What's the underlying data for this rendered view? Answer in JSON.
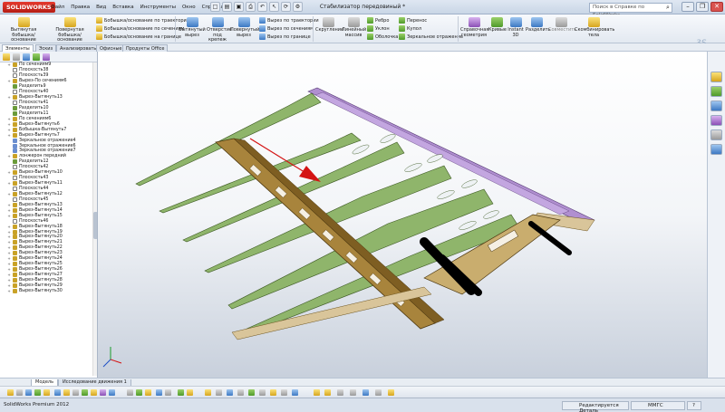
{
  "app": {
    "logo": "SOLIDWORKS",
    "document_title": "Стабилизатор передовиный *",
    "menu": [
      "Файл",
      "Правка",
      "Вид",
      "Вставка",
      "Инструменты",
      "Окно",
      "Справка"
    ],
    "search_placeholder": "Поиск в Справке по SolidWorks",
    "window_controls": [
      "minimize-icon",
      "restore-icon",
      "close-icon"
    ]
  },
  "ribbon": {
    "big_buttons": [
      {
        "label": "Вытянутая бобышка/основание",
        "icon": "extrude-boss-icon"
      },
      {
        "label": "Повернутая бобышка/основание",
        "icon": "revolve-boss-icon"
      },
      {
        "label": "Вытянутый вырез",
        "icon": "extrude-cut-icon"
      },
      {
        "label": "Отверстие под крепеж",
        "icon": "hole-wizard-icon"
      },
      {
        "label": "Повернутый вырез",
        "icon": "revolve-cut-icon"
      },
      {
        "label": "Скругление",
        "icon": "fillet-icon"
      },
      {
        "label": "Линейный массив",
        "icon": "linear-pattern-icon"
      },
      {
        "label": "Справочная геометрия",
        "icon": "reference-geometry-icon"
      },
      {
        "label": "Кривые",
        "icon": "curves-icon"
      },
      {
        "label": "Instant 3D",
        "icon": "instant3d-icon"
      },
      {
        "label": "Разделить",
        "icon": "split-icon"
      },
      {
        "label": "Совместить",
        "icon": "combine-disabled-icon"
      },
      {
        "label": "Скомбинировать тела",
        "icon": "combine-bodies-icon"
      }
    ],
    "small_items": [
      "Бобышка/основание по траектории",
      "Бобышка/основание по сечениям",
      "Бобышка/основание на границе",
      "Вырез по траектории",
      "Вырез по сечениям",
      "Вырез по границе",
      "Ребро",
      "Уклон",
      "Оболочка",
      "Перенос",
      "Купол",
      "Зеркальное отражение"
    ]
  },
  "tabs": [
    "Элементы",
    "Эскиз",
    "Анализировать",
    "Офисные",
    "Продукты Office"
  ],
  "feature_tree": [
    {
      "label": "По сечениям9",
      "icon": "feature"
    },
    {
      "label": "Плоскость38",
      "icon": "plane"
    },
    {
      "label": "Плоскость39",
      "icon": "plane"
    },
    {
      "label": "Вырез-По сечениям6",
      "icon": "feature"
    },
    {
      "label": "Разделить9",
      "icon": "split"
    },
    {
      "label": "Плоскость40",
      "icon": "plane"
    },
    {
      "label": "Вырез-Вытянуть13",
      "icon": "feature"
    },
    {
      "label": "Плоскость41",
      "icon": "plane"
    },
    {
      "label": "Разделить10",
      "icon": "split"
    },
    {
      "label": "Разделить11",
      "icon": "split"
    },
    {
      "label": "По сечениям6",
      "icon": "feature"
    },
    {
      "label": "Вырез-Вытянуть6",
      "icon": "feature"
    },
    {
      "label": "Бобышка-Вытянуть7",
      "icon": "feature"
    },
    {
      "label": "Вырез-Вытянуть7",
      "icon": "feature"
    },
    {
      "label": "Зеркальное отражение4",
      "icon": "mirror"
    },
    {
      "label": "Зеркальное отражение6",
      "icon": "mirror"
    },
    {
      "label": "Зеркальное отражение7",
      "icon": "mirror"
    },
    {
      "label": "лонжерон передний",
      "icon": "feature"
    },
    {
      "label": "Разделить12",
      "icon": "split"
    },
    {
      "label": "Плоскость42",
      "icon": "plane"
    },
    {
      "label": "Вырез-Вытянуть10",
      "icon": "feature"
    },
    {
      "label": "Плоскость43",
      "icon": "plane"
    },
    {
      "label": "Вырез-Вытянуть11",
      "icon": "feature"
    },
    {
      "label": "Плоскость44",
      "icon": "plane"
    },
    {
      "label": "Вырез-Вытянуть12",
      "icon": "feature"
    },
    {
      "label": "Плоскость45",
      "icon": "plane"
    },
    {
      "label": "Вырез-Вытянуть13",
      "icon": "feature"
    },
    {
      "label": "Вырез-Вытянуть14",
      "icon": "feature"
    },
    {
      "label": "Вырез-Вытянуть15",
      "icon": "feature"
    },
    {
      "label": "Плоскость46",
      "icon": "plane"
    },
    {
      "label": "Вырез-Вытянуть18",
      "icon": "feature"
    },
    {
      "label": "Вырез-Вытянуть19",
      "icon": "feature"
    },
    {
      "label": "Вырез-Вытянуть20",
      "icon": "feature"
    },
    {
      "label": "Вырез-Вытянуть21",
      "icon": "feature"
    },
    {
      "label": "Вырез-Вытянуть22",
      "icon": "feature"
    },
    {
      "label": "Вырез-Вытянуть23",
      "icon": "feature"
    },
    {
      "label": "Вырез-Вытянуть24",
      "icon": "feature"
    },
    {
      "label": "Вырез-Вытянуть25",
      "icon": "feature"
    },
    {
      "label": "Вырез-Вытянуть26",
      "icon": "feature"
    },
    {
      "label": "Вырез-Вытянуть27",
      "icon": "feature"
    },
    {
      "label": "Вырез-Вытянуть28",
      "icon": "feature"
    },
    {
      "label": "Вырез-Вытянуть29",
      "icon": "feature"
    },
    {
      "label": "Вырез-Вытянуть30",
      "icon": "feature"
    }
  ],
  "bottom_tabs": [
    "Модель",
    "Исследование движения 1"
  ],
  "status": {
    "version": "SolidWorks Premium 2012",
    "mode": "Редактируется Деталь",
    "units": "ММГС",
    "help": "?"
  },
  "colors": {
    "rib_green": "#8fb56b",
    "spar_brown": "#8a6a2c",
    "skin_purple": "#b08fd0",
    "tube_black": "#1b1b1b",
    "arrow_red": "#d41414",
    "ribbon_bg": "#eef2f7",
    "titlebar_bg": "#d3deeb"
  }
}
